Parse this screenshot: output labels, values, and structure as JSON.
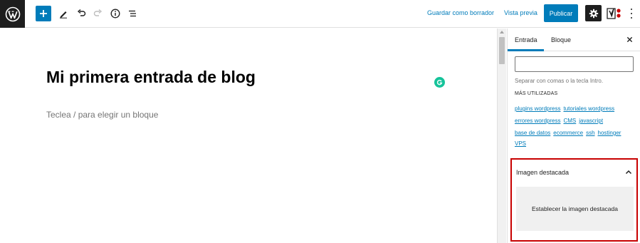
{
  "toolbar": {
    "save_draft_label": "Guardar como borrador",
    "preview_label": "Vista previa",
    "publish_label": "Publicar",
    "icons": {
      "logo": "wordpress-icon",
      "add": "plus-icon",
      "tools": "pencil-icon",
      "undo": "undo-icon",
      "redo": "redo-icon",
      "details": "info-icon",
      "outline": "list-view-icon",
      "settings": "gear-icon",
      "yoast": "yoast-icon",
      "more": "more-vertical-icon"
    }
  },
  "editor": {
    "post_title": "Mi primera entrada de blog",
    "block_placeholder": "Teclea / para elegir un bloque"
  },
  "sidebar": {
    "tabs": [
      {
        "label": "Entrada",
        "active": true
      },
      {
        "label": "Bloque",
        "active": false
      }
    ],
    "tags": {
      "input_value": "",
      "help_text": "Separar con comas o la tecla Intro.",
      "most_used_heading": "MÁS UTILIZADAS",
      "most_used": [
        "plugins wordpress",
        "tutoriales wordpress",
        "errores wordpress",
        "CMS",
        "javascript",
        "base de datos",
        "ecommerce",
        "ssh",
        "hostinger",
        "VPS"
      ]
    },
    "featured_image": {
      "title": "Imagen destacada",
      "button_label": "Establecer la imagen destacada"
    }
  },
  "colors": {
    "accent": "#007cba",
    "highlight_border": "#c80000",
    "dark": "#1e1e1e",
    "grammarly": "#15c39a"
  }
}
